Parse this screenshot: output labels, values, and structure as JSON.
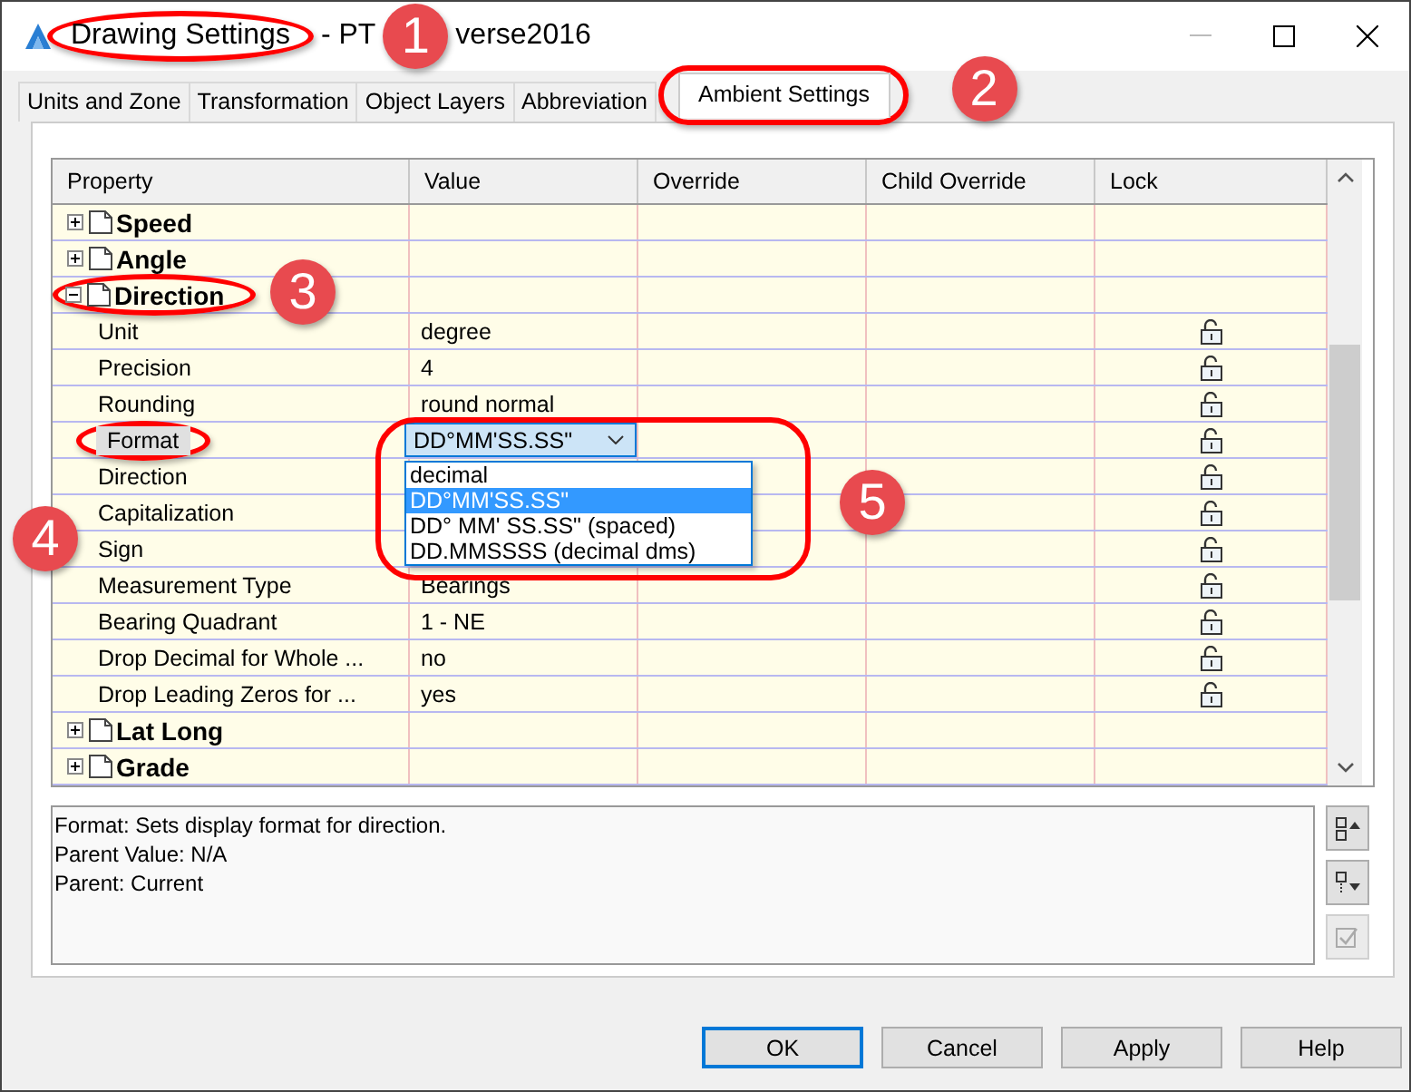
{
  "window": {
    "title_parts": [
      "Drawing Settings",
      "- PT",
      "verse2016"
    ]
  },
  "tabs": [
    {
      "label": "Units and Zone",
      "selected": false
    },
    {
      "label": "Transformation",
      "selected": false
    },
    {
      "label": "Object Layers",
      "selected": false
    },
    {
      "label": "Abbreviation",
      "selected": false
    },
    {
      "label": "Ambient Settings",
      "selected": true
    }
  ],
  "grid": {
    "columns": [
      "Property",
      "Value",
      "Override",
      "Child Override",
      "Lock"
    ],
    "groups": [
      {
        "label": "Speed",
        "expanded": false
      },
      {
        "label": "Angle",
        "expanded": false
      },
      {
        "label": "Direction",
        "expanded": true,
        "children": [
          {
            "label": "Unit",
            "kind": "text",
            "selected": false,
            "value": "degree"
          },
          {
            "label": "Precision",
            "kind": "text",
            "selected": false,
            "value": "4"
          },
          {
            "label": "Rounding",
            "kind": "text",
            "selected": false,
            "value": "round normal"
          },
          {
            "label": "Format",
            "kind": "dropdown",
            "selected": true,
            "value": "DD°MM'SS.SS\"",
            "options": [
              {
                "label": "decimal",
                "selected": false
              },
              {
                "label": "DD°MM'SS.SS\"",
                "selected": true
              },
              {
                "label": "DD° MM' SS.SS\" (spaced)",
                "selected": false
              },
              {
                "label": "DD.MMSSSS (decimal dms)",
                "selected": false
              }
            ]
          },
          {
            "label": "Direction",
            "kind": "text",
            "selected": false
          },
          {
            "label": "Capitalization",
            "kind": "text",
            "selected": false
          },
          {
            "label": "Sign",
            "kind": "text",
            "selected": false
          },
          {
            "label": "Measurement Type",
            "kind": "text",
            "selected": false,
            "value": "Bearings"
          },
          {
            "label": "Bearing Quadrant",
            "kind": "text",
            "selected": false,
            "value": "1 - NE"
          },
          {
            "label": "Drop Decimal for Whole ...",
            "kind": "text",
            "selected": false,
            "value": "no"
          },
          {
            "label": "Drop Leading Zeros for ...",
            "kind": "text",
            "selected": false,
            "value": "yes"
          }
        ]
      },
      {
        "label": "Lat Long",
        "expanded": false
      },
      {
        "label": "Grade",
        "expanded": false
      }
    ]
  },
  "description": [
    "Format: Sets display format for direction.",
    "Parent Value: N/A",
    "Parent: Current"
  ],
  "side_buttons": [
    {
      "disabled": false
    },
    {
      "disabled": false
    },
    {
      "disabled": true
    }
  ],
  "buttons": [
    {
      "label": "OK",
      "default": true
    },
    {
      "label": "Cancel",
      "default": false
    },
    {
      "label": "Apply",
      "default": false
    },
    {
      "label": "Help",
      "default": false
    }
  ],
  "callouts": [
    "1",
    "2",
    "3",
    "4",
    "5"
  ]
}
